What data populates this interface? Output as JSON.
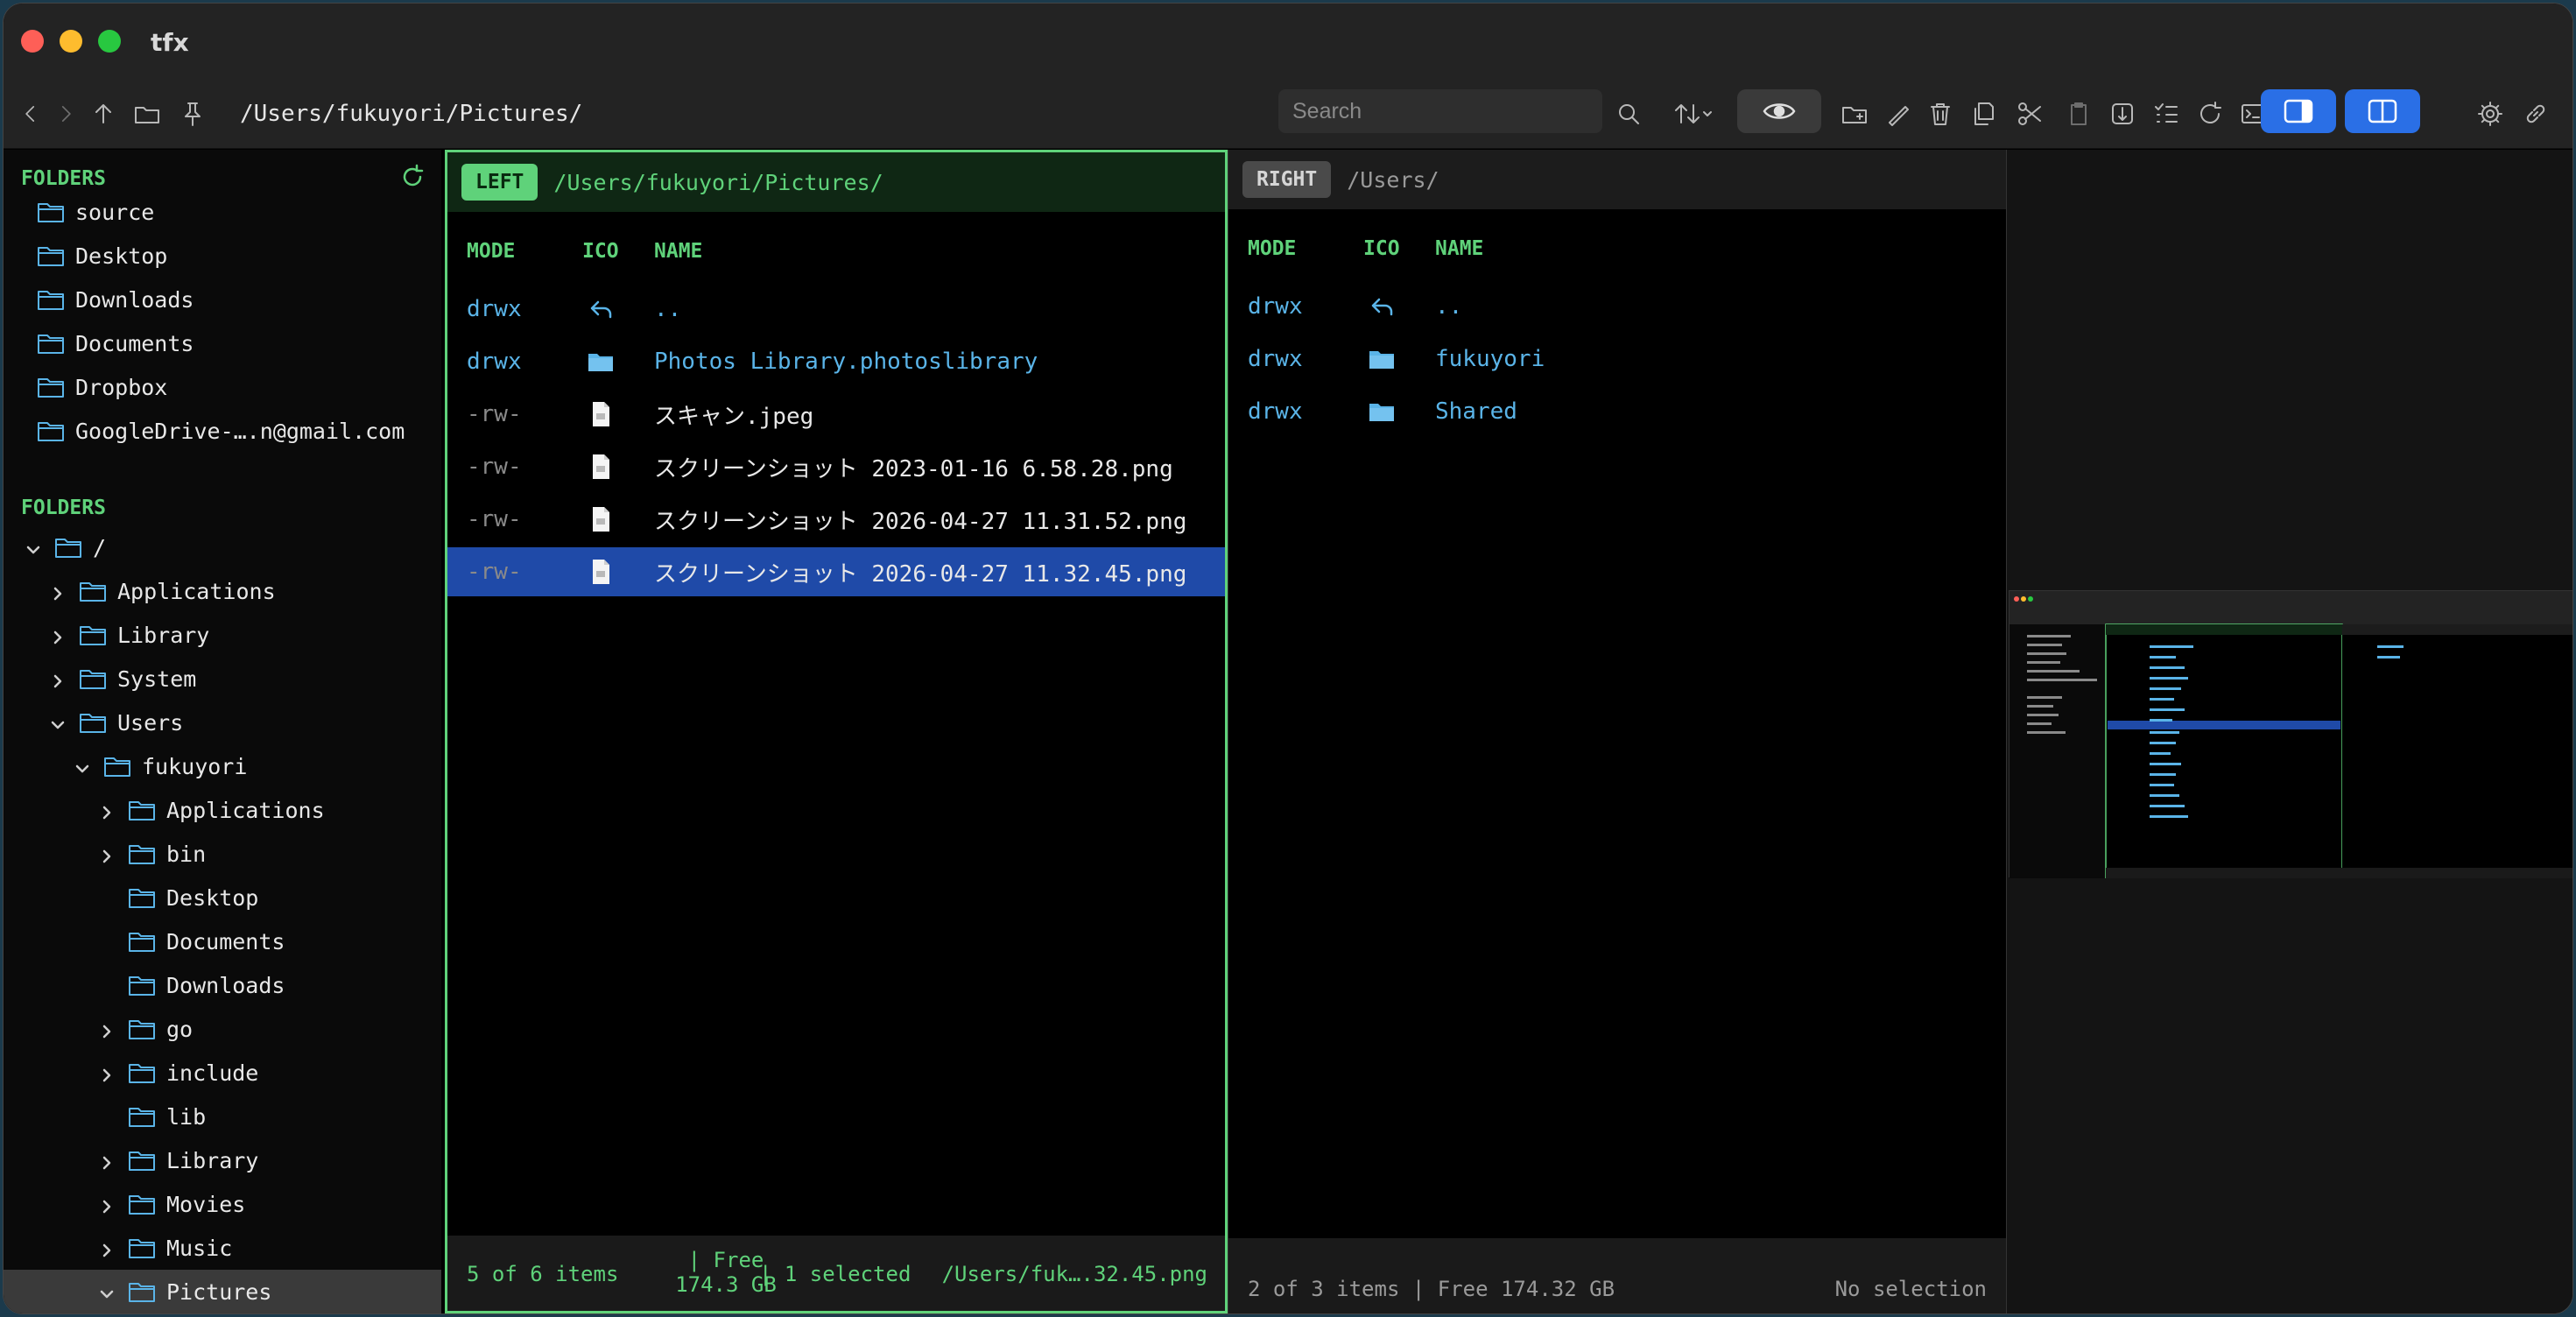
{
  "app": {
    "title": "tfx"
  },
  "toolbar": {
    "path": "/Users/fukuyori/Pictures/",
    "search_placeholder": "Search"
  },
  "sidebar": {
    "favorites_header": "FOLDERS",
    "favorites": [
      "source",
      "Desktop",
      "Downloads",
      "Documents",
      "Dropbox",
      "GoogleDrive-….n@gmail.com"
    ],
    "tree_header": "FOLDERS",
    "tree": [
      {
        "label": "/",
        "depth": 0,
        "state": "expanded"
      },
      {
        "label": "Applications",
        "depth": 1,
        "state": "collapsed"
      },
      {
        "label": "Library",
        "depth": 1,
        "state": "collapsed"
      },
      {
        "label": "System",
        "depth": 1,
        "state": "collapsed"
      },
      {
        "label": "Users",
        "depth": 1,
        "state": "expanded"
      },
      {
        "label": "fukuyori",
        "depth": 2,
        "state": "expanded"
      },
      {
        "label": "Applications",
        "depth": 3,
        "state": "collapsed"
      },
      {
        "label": "bin",
        "depth": 3,
        "state": "collapsed"
      },
      {
        "label": "Desktop",
        "depth": 3,
        "state": "none"
      },
      {
        "label": "Documents",
        "depth": 3,
        "state": "none"
      },
      {
        "label": "Downloads",
        "depth": 3,
        "state": "none"
      },
      {
        "label": "go",
        "depth": 3,
        "state": "collapsed"
      },
      {
        "label": "include",
        "depth": 3,
        "state": "collapsed"
      },
      {
        "label": "lib",
        "depth": 3,
        "state": "none"
      },
      {
        "label": "Library",
        "depth": 3,
        "state": "collapsed"
      },
      {
        "label": "Movies",
        "depth": 3,
        "state": "collapsed"
      },
      {
        "label": "Music",
        "depth": 3,
        "state": "collapsed"
      },
      {
        "label": "Pictures",
        "depth": 3,
        "state": "expanded",
        "selected": true
      }
    ]
  },
  "left_pane": {
    "badge": "LEFT",
    "path": "/Users/fukuyori/Pictures/",
    "columns": {
      "mode": "MODE",
      "ico": "ICO",
      "name": "NAME"
    },
    "rows": [
      {
        "mode": "drwx",
        "type": "up",
        "name": ".."
      },
      {
        "mode": "drwx",
        "type": "folder",
        "name": "Photos Library.photoslibrary"
      },
      {
        "mode": "-rw-",
        "type": "file",
        "name": "スキャン.jpeg"
      },
      {
        "mode": "-rw-",
        "type": "file",
        "name": "スクリーンショット 2023-01-16 6.58.28.png"
      },
      {
        "mode": "-rw-",
        "type": "file",
        "name": "スクリーンショット 2026-04-27 11.31.52.png"
      },
      {
        "mode": "-rw-",
        "type": "file",
        "name": "スクリーンショット 2026-04-27 11.32.45.png",
        "selected": true
      }
    ],
    "status": {
      "items": "5 of 6 items",
      "free_line1": "| Free",
      "free_line2": "174.3 GB",
      "selected": "| 1 selected",
      "selected_path": "/Users/fuk….32.45.png"
    }
  },
  "right_pane": {
    "badge": "RIGHT",
    "path": "/Users/",
    "columns": {
      "mode": "MODE",
      "ico": "ICO",
      "name": "NAME"
    },
    "rows": [
      {
        "mode": "drwx",
        "type": "up",
        "name": ".."
      },
      {
        "mode": "drwx",
        "type": "folder",
        "name": "fukuyori"
      },
      {
        "mode": "drwx",
        "type": "folder",
        "name": "Shared"
      }
    ],
    "status": {
      "items": "2 of 3 items | Free 174.32 GB",
      "selection": "No selection"
    }
  },
  "colors": {
    "accent": "#5fd27a",
    "directory": "#5ab4e8",
    "selection": "#1f4aa8",
    "primary_button": "#2a6fe6"
  }
}
